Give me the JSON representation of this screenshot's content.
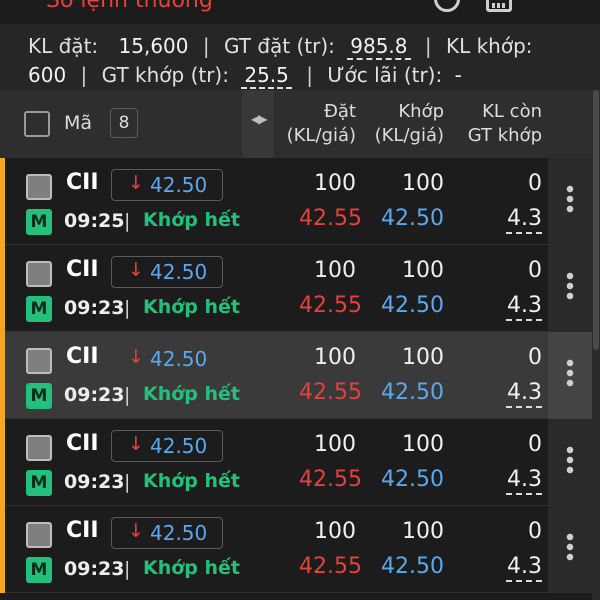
{
  "header": {
    "title": "Sổ lệnh thường"
  },
  "summary": {
    "kl_dat_label": "KL đặt:",
    "kl_dat_value": "15,600",
    "gt_dat_label": "GT đặt (tr):",
    "gt_dat_value": "985.8",
    "kl_khop_label": "KL khớp:",
    "kl_khop_value": "600",
    "gt_khop_label": "GT khớp (tr):",
    "gt_khop_value": "25.5",
    "uoc_lai_label": "Ước lãi (tr):",
    "uoc_lai_value": "-"
  },
  "table": {
    "col_ma": "Mã",
    "count": "8",
    "col_dat_1": "Đặt",
    "col_dat_2": "(KL/giá)",
    "col_khop_1": "Khớp",
    "col_khop_2": "(KL/giá)",
    "col_klcon_1": "KL còn",
    "col_klcon_2": "GT khớp"
  },
  "rows": [
    {
      "symbol": "CII",
      "price": "42.50",
      "badge": "M",
      "time": "09:25",
      "status": "Khớp hết",
      "dat_qty": "100",
      "dat_price": "42.55",
      "khop_qty": "100",
      "khop_price": "42.50",
      "kl_con": "0",
      "gt_khop": "4.3"
    },
    {
      "symbol": "CII",
      "price": "42.50",
      "badge": "M",
      "time": "09:23",
      "status": "Khớp hết",
      "dat_qty": "100",
      "dat_price": "42.55",
      "khop_qty": "100",
      "khop_price": "42.50",
      "kl_con": "0",
      "gt_khop": "4.3"
    },
    {
      "symbol": "CII",
      "price": "42.50",
      "badge": "M",
      "time": "09:23",
      "status": "Khớp hết",
      "dat_qty": "100",
      "dat_price": "42.55",
      "khop_qty": "100",
      "khop_price": "42.50",
      "kl_con": "0",
      "gt_khop": "4.3"
    },
    {
      "symbol": "CII",
      "price": "42.50",
      "badge": "M",
      "time": "09:23",
      "status": "Khớp hết",
      "dat_qty": "100",
      "dat_price": "42.55",
      "khop_qty": "100",
      "khop_price": "42.50",
      "kl_con": "0",
      "gt_khop": "4.3"
    },
    {
      "symbol": "CII",
      "price": "42.50",
      "badge": "M",
      "time": "09:23",
      "status": "Khớp hết",
      "dat_qty": "100",
      "dat_price": "42.55",
      "khop_qty": "100",
      "khop_price": "42.50",
      "kl_con": "0",
      "gt_khop": "4.3"
    }
  ],
  "colors": {
    "accent": "#f5a623",
    "buy_red": "#e5413d",
    "price_blue": "#5aa8f0",
    "matched_green": "#22c07a"
  },
  "icons": {
    "top_1": "refresh-icon",
    "top_2": "calendar-icon",
    "top_3": "more-vertical-icon",
    "price_arrow": "arrow-down-icon",
    "row_menu": "more-vertical-icon"
  }
}
